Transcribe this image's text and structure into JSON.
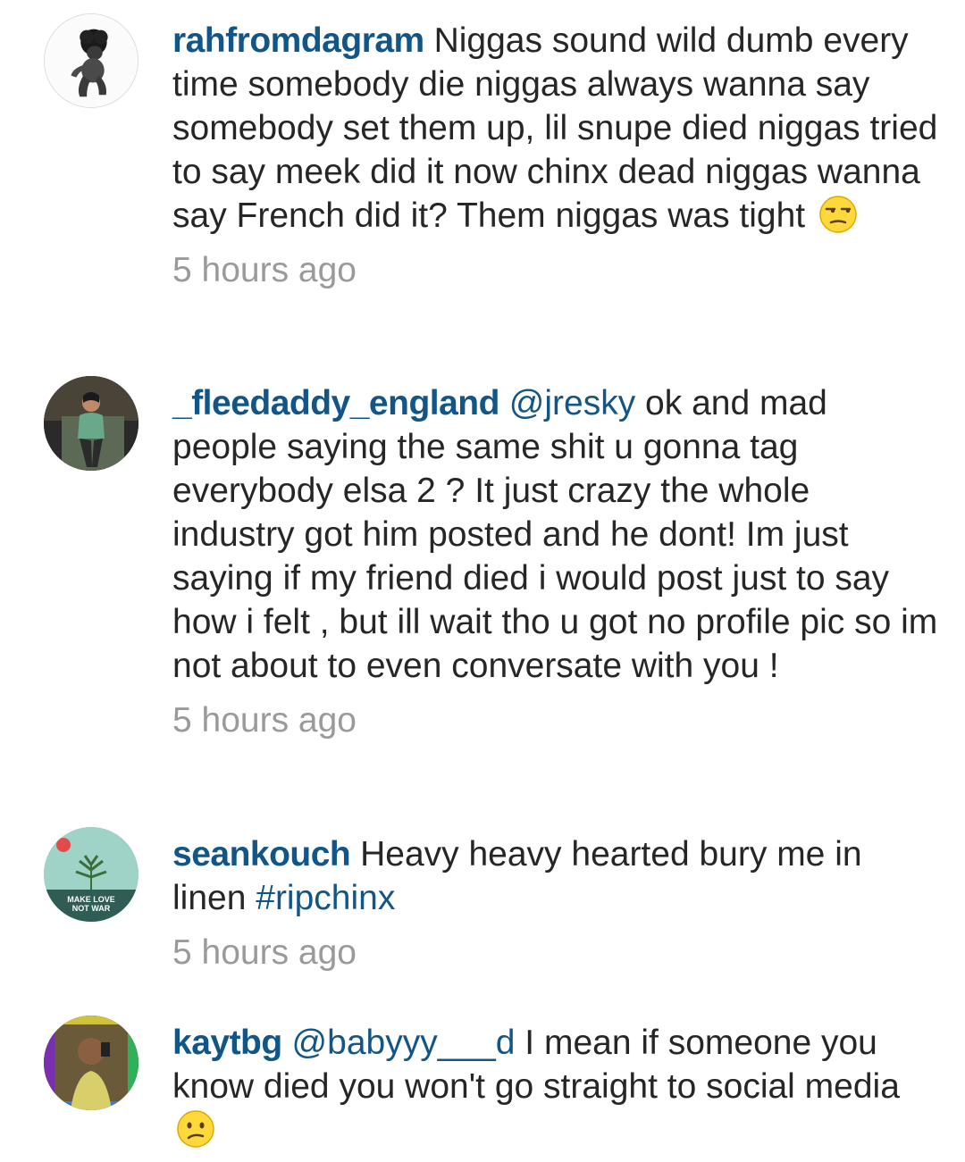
{
  "comments": [
    {
      "username": "rahfromdagram",
      "mention": "",
      "text": "Niggas sound wild dumb every time somebody die niggas always wanna say somebody set them up, lil snupe died niggas tried to say meek did it now chinx dead niggas wanna say French did it? Them niggas was tight",
      "emoji": "unamused-face-emoji",
      "time": "5 hours ago"
    },
    {
      "username": "_fleedaddy_england",
      "mention": "@jresky",
      "text": " ok and mad people saying the same shit u gonna tag everybody elsa 2 ? It just crazy the whole industry got him posted and he dont! Im just saying if my friend died i would post just to say how i felt , but ill wait tho u got no profile pic so im not about to even conversate with you !",
      "emoji": "",
      "time": "5 hours ago"
    },
    {
      "username": "seankouch",
      "mention": "",
      "text": "Heavy heavy hearted bury me in linen",
      "hashtag": "#ripchinx",
      "avatar_text": "MAKE LOVE NOT WAR",
      "emoji": "",
      "time": "5 hours ago"
    },
    {
      "username": "kaytbg",
      "mention": "@babyyy___d",
      "text": " I mean if someone you know died you won't go straight to social media",
      "emoji": "confused-face-emoji",
      "time": ""
    }
  ],
  "colors": {
    "username": "#125688",
    "text": "#262626",
    "timestamp": "#9a9a9a",
    "background": "#ffffff"
  }
}
